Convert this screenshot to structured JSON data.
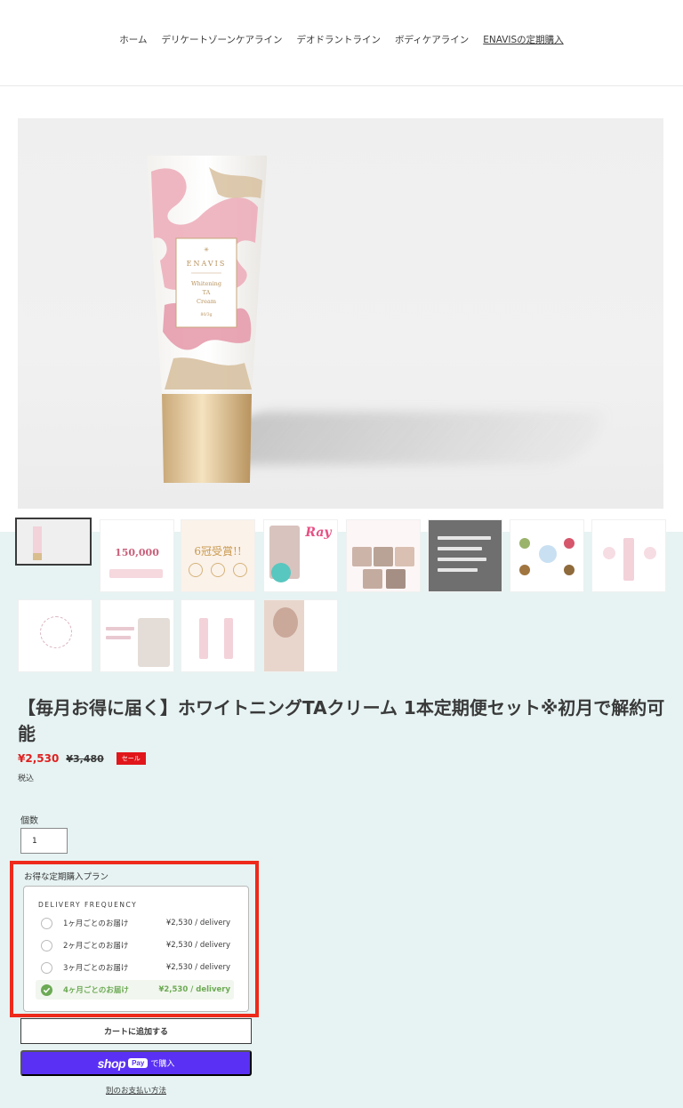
{
  "nav": {
    "items": [
      {
        "label": "ホーム"
      },
      {
        "label": "デリケートゾーンケアライン"
      },
      {
        "label": "デオドラントライン"
      },
      {
        "label": "ボディケアライン"
      },
      {
        "label": "ENAVISの定期購入",
        "active": true
      }
    ]
  },
  "hero": {
    "brand": "ENAVIS",
    "product_line1": "Whitening",
    "product_line2": "TA",
    "product_line3": "Cream",
    "weight": "80/3g"
  },
  "thumbnails": [
    {
      "caption": ""
    },
    {
      "caption": "150,000"
    },
    {
      "caption": "6冠受賞!!"
    },
    {
      "caption": "Ray"
    },
    {
      "caption": ""
    },
    {
      "caption": ""
    },
    {
      "caption": ""
    },
    {
      "caption": ""
    },
    {
      "caption": ""
    },
    {
      "caption": ""
    },
    {
      "caption": ""
    },
    {
      "caption": ""
    }
  ],
  "product": {
    "title": "【毎月お得に届く】ホワイトニングTAクリーム 1本定期便セット※初月で解約可能",
    "price_sale": "¥2,530",
    "price_original": "¥3,480",
    "sale_badge": "セール",
    "tax_note": "税込"
  },
  "quantity": {
    "label": "個数",
    "value": "1"
  },
  "plan": {
    "title": "お得な定期購入プラン",
    "frequency_label": "DELIVERY FREQUENCY",
    "options": [
      {
        "name": "1ヶ月ごとのお届け",
        "price": "¥2,530  /  delivery",
        "selected": false
      },
      {
        "name": "2ヶ月ごとのお届け",
        "price": "¥2,530  /  delivery",
        "selected": false
      },
      {
        "name": "3ヶ月ごとのお届け",
        "price": "¥2,530  /  delivery",
        "selected": false
      },
      {
        "name": "4ヶ月ごとのお届け",
        "price": "¥2,530  /  delivery",
        "selected": true
      }
    ]
  },
  "actions": {
    "add_to_cart": "カートに追加する",
    "shop_pay_brand": "shop",
    "shop_pay_badge": "Pay",
    "shop_pay_buy": "で購入",
    "other_payment": "別のお支払い方法"
  },
  "colors": {
    "sale_red": "#e02020",
    "highlight_outline": "#ee2a1b",
    "shop_pay_purple": "#5a31f4",
    "selected_green": "#6caa54",
    "thumb_bg": "#e6f3f2"
  }
}
